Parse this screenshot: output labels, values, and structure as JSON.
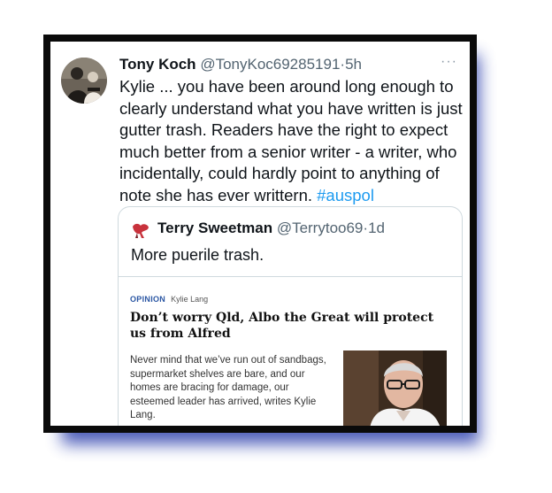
{
  "tweet": {
    "author_name": "Tony Koch",
    "author_handle": "@TonyKoc69285191",
    "separator": "·",
    "time": "5h",
    "more_icon": "···",
    "text": "Kylie ... you have been around long enough to clearly understand what you have written is just gutter trash.  Readers have the right to expect much better from a senior writer - a writer, who incidentally, could hardly point to anything of note she has ever writtern. ",
    "hashtag": "#auspol"
  },
  "quoted": {
    "author_name": "Terry Sweetman",
    "author_handle": "@Terrytoo69",
    "separator": "·",
    "time": "1d",
    "text": "More puerile trash."
  },
  "article": {
    "section": "OPINION",
    "author": "Kylie Lang",
    "headline": "Don’t worry Qld, Albo the Great will protect us from Alfred",
    "standfirst": "Never mind that we’ve run out of sandbags, supermarket shelves are bare, and our homes are bracing for damage, our esteemed leader has arrived, writes Kylie Lang."
  },
  "colors": {
    "frame": "#0a0a0a",
    "shadow": "#4657b7",
    "hashtag": "#1d9bf0",
    "muted": "#536471",
    "section_label": "#2a56a3"
  }
}
